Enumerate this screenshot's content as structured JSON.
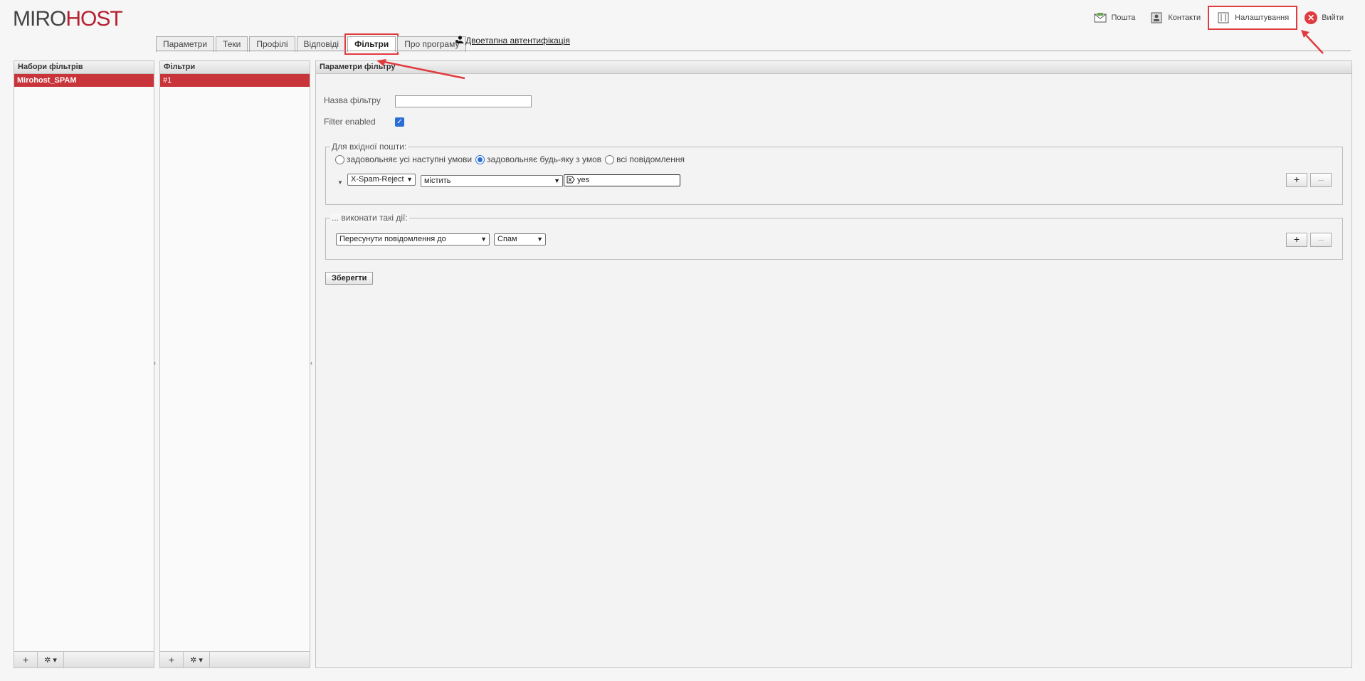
{
  "logo": {
    "part1": "MIRO",
    "part2": "HOST"
  },
  "topbar": {
    "mail": "Пошта",
    "contacts": "Контакти",
    "settings": "Налаштування",
    "logout": "Вийти"
  },
  "tabs": [
    {
      "label": "Параметри"
    },
    {
      "label": "Теки"
    },
    {
      "label": "Профілі"
    },
    {
      "label": "Відповіді"
    },
    {
      "label": "Фільтри"
    },
    {
      "label": "Про програму"
    }
  ],
  "twofa_label": "Двоетапна автентифікація",
  "filtersets": {
    "title": "Набори фільтрів",
    "items": [
      "Mirohost_SPAM"
    ]
  },
  "filters": {
    "title": "Фільтри",
    "items": [
      "#1"
    ]
  },
  "params": {
    "title": "Параметри фільтру",
    "name_label": "Назва фільтру",
    "name_value": "",
    "enabled_label": "Filter enabled",
    "incoming_legend": "Для вхідної пошти:",
    "radio_all": "задовольняє усі наступні умови",
    "radio_any": "задовольняє будь-яку з умов",
    "radio_every": "всі повідомлення",
    "rule_header": "X-Spam-Reject",
    "rule_op": "містить",
    "rule_value": "yes",
    "actions_legend": "... виконати такі дії:",
    "action": "Пересунути повідомлення до",
    "action_target": "Спам",
    "save": "Зберегти"
  },
  "colors": {
    "accent": "#c9343a",
    "highlight": "#e03c40",
    "checkbox": "#2b6fd6"
  }
}
